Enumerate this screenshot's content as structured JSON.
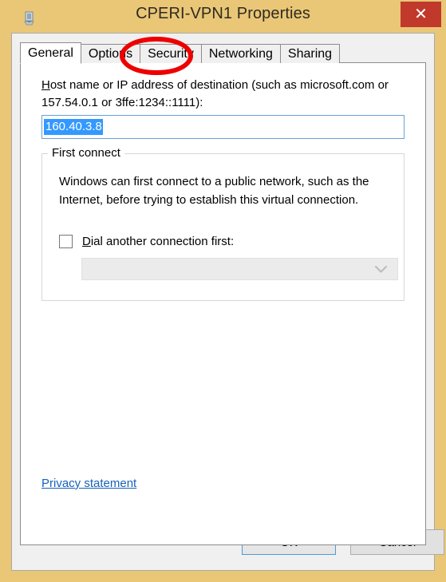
{
  "window": {
    "title": "CPERI-VPN1 Properties",
    "icon": "network-connection-icon",
    "close_label": "✕",
    "frame_color": "#e9c777",
    "close_button_color": "#c0392b"
  },
  "tabs": [
    {
      "label": "General",
      "active": true
    },
    {
      "label": "Options",
      "active": false
    },
    {
      "label": "Security",
      "active": false
    },
    {
      "label": "Networking",
      "active": false
    },
    {
      "label": "Sharing",
      "active": false
    }
  ],
  "general_tab": {
    "host_label": {
      "accel": "H",
      "rest": "ost name or IP address of destination (such as microsoft.com or 157.54.0.1 or 3ffe:1234::1111):"
    },
    "host_input": {
      "value": "160.40.3.8",
      "placeholder": "",
      "selected": true,
      "selection_color": "#3399ff"
    },
    "first_connect": {
      "legend": "First connect",
      "description": "Windows can first connect to a public network, such as the Internet, before trying to establish this virtual connection.",
      "dial_checkbox": {
        "checked": false,
        "accel": "D",
        "rest": "ial another connection first:"
      },
      "dial_combo": {
        "value": "",
        "enabled": false,
        "chevron": "⌄"
      }
    },
    "privacy_link": "Privacy statement"
  },
  "buttons": {
    "ok": "OK",
    "cancel": "Cancel"
  },
  "annotation": {
    "target": "Security",
    "shape": "red-ellipse-highlight",
    "color": "#ee0000"
  }
}
